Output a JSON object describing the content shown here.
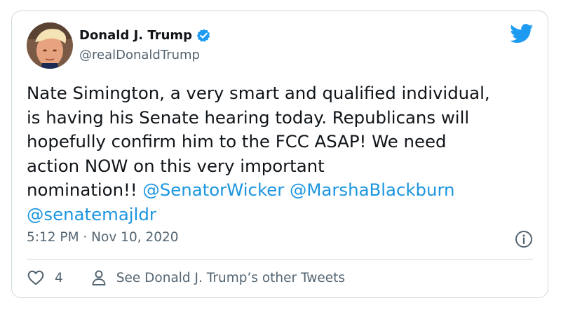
{
  "tweet": {
    "author_name": "Donald J. Trump",
    "handle": "@realDonaldTrump",
    "lines": [
      "Nate Simington, a very smart and qualified individual,",
      "is having his Senate hearing today. Republicans will",
      "hopefully confirm him to the FCC ASAP! We need",
      "action NOW on this very important"
    ],
    "line5_text": "nomination!!",
    "mentions": [
      "@SenatorWicker",
      "@MarshaBlackburn",
      "@senatemajldr"
    ],
    "timestamp": "5:12 PM · Nov 10, 2020",
    "like_count": "4",
    "see_more_label": "See Donald J. Trump’s other Tweets"
  },
  "colors": {
    "accent": "#1d9bf0",
    "mention": "#1b95e0",
    "secondary_text": "#536471",
    "border": "#cfd9de"
  },
  "icons": {
    "verified": "verified-badge-icon",
    "brand": "twitter-bird-icon",
    "info": "info-icon",
    "like": "heart-icon",
    "profile": "person-icon"
  }
}
